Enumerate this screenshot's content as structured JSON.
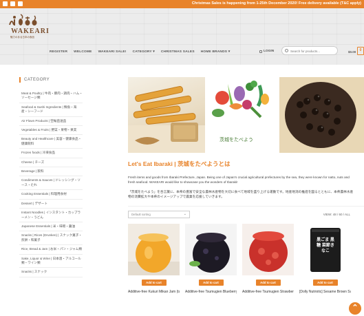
{
  "topbar": {
    "announcement": "Christmas Sales is happening from 1-25th December 2020! Free delivery available (T&C apply)",
    "social_icons": [
      "facebook-icon",
      "instagram-icon",
      "email-icon"
    ]
  },
  "header": {
    "logo_name": "WAKEARI",
    "logo_sub": "魅力のある日本の食品",
    "nav": [
      "REGISTER",
      "WELCOME",
      "WAKEARI SALE!",
      "CATEGORY ▾",
      "CHRISTMAS SALES",
      "HOME BRANDS ▾"
    ],
    "login": "LOGIN",
    "search_placeholder": "Search for products...",
    "cart_total": "$0.00",
    "cart_count": "0"
  },
  "sidebar": {
    "title": "CATEGORY",
    "items": [
      "Meat & Poultry | 牛肉・豚肉・鶏肉・ハム・ソーセージ類",
      "Seafood & Sushi Ingredients | 鮮魚・海産・シーフード",
      "Air Flown Products | 空輸直送品",
      "Vegetables & Fruits | 野菜・果物・果実",
      "Beauty and Healthcare | 美容・健康食品・健康飲料",
      "Frozen foods | 冷凍食品",
      "Cheese | チーズ",
      "Beverage | 飲料",
      "Condiments & Sauces | ドレッシング・ソース・たれ",
      "Cooking Essentials | 料理用食材",
      "Dessert | デザート",
      "Instant Noodles | インスタント・カップラーメン・うどん",
      "Japanese Essentials | 米・味噌・醤油",
      "Snacks | Rices (Drunken) | スナック菓子・煎餅・和菓子",
      "Rice, Bread & Jam | お米・パン・ジャム類",
      "Sake, Liquor & Wine | 日本酒・アルコール類・ワイン類",
      "Snacks | スナック"
    ]
  },
  "main": {
    "heading": "Let's Eat Ibaraki | 茨城をたべようとは",
    "hero_caption": "茨城をたべよう",
    "para1": "Fresh items and goods from Ibaraki Prefecture, Japan. Being one of Japan's crucial agricultural prefectures by the sea, they were known for natto, nuts and fresh seafood. WAKEARI would like to showcase you the wonders of Ibaraki!",
    "para2": "「茨城をたべよう」を合言葉に、本県の豊富で安全な農林水産物を大切に食べて地域を盛り上げる運動です。地産地消の推進を図るとともに、本県農林水産物の消費拡大や本県のイメージアップで農業を応援していきます。",
    "sort_label": "Default sorting",
    "view_label": "VIEW: 48 / 60 / ALL",
    "add_to_cart": "Add to cart",
    "products": [
      {
        "name": "Additive-free Kukuri Mikan Jam (tangerine) | 無"
      },
      {
        "name": "Additive-free Tsumugien Blueberry Jam | 無添加つ"
      },
      {
        "name": "Additive-free Tsumugien Strawberry Jam | 無添加・"
      },
      {
        "name": "[Dolly Nutriotic] Sesame Brown Sugar"
      }
    ],
    "product4_label": "黒ごま 黒糖 菜節きなこ"
  },
  "colors": {
    "accent": "#e8832a",
    "brand_brown": "#7a4e2d"
  }
}
